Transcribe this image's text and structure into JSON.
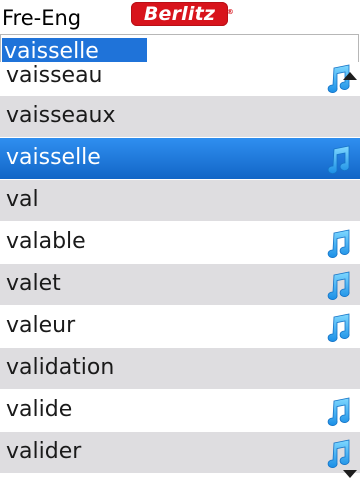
{
  "app": {
    "title": "Fre-Eng",
    "logo_text": "Berlitz",
    "logo_mark": "®",
    "logo_color": "#d8141c"
  },
  "search": {
    "value": "vaisselle",
    "highlight_color": "#1f73d9"
  },
  "list": {
    "items": [
      {
        "word": "vaisseau",
        "has_audio": true,
        "selected": false
      },
      {
        "word": "vaisseaux",
        "has_audio": false,
        "selected": false
      },
      {
        "word": "vaisselle",
        "has_audio": true,
        "selected": true
      },
      {
        "word": "val",
        "has_audio": false,
        "selected": false
      },
      {
        "word": "valable",
        "has_audio": true,
        "selected": false
      },
      {
        "word": "valet",
        "has_audio": true,
        "selected": false
      },
      {
        "word": "valeur",
        "has_audio": true,
        "selected": false
      },
      {
        "word": "validation",
        "has_audio": false,
        "selected": false
      },
      {
        "word": "valide",
        "has_audio": true,
        "selected": false
      },
      {
        "word": "valider",
        "has_audio": true,
        "selected": false
      }
    ],
    "audio_icon": "music-note-icon",
    "selected_color": "#1f7ae0",
    "alt_row_color": "#dedde0"
  },
  "scroll": {
    "up_icon": "scroll-up-arrow-icon",
    "down_icon": "scroll-down-arrow-icon"
  }
}
